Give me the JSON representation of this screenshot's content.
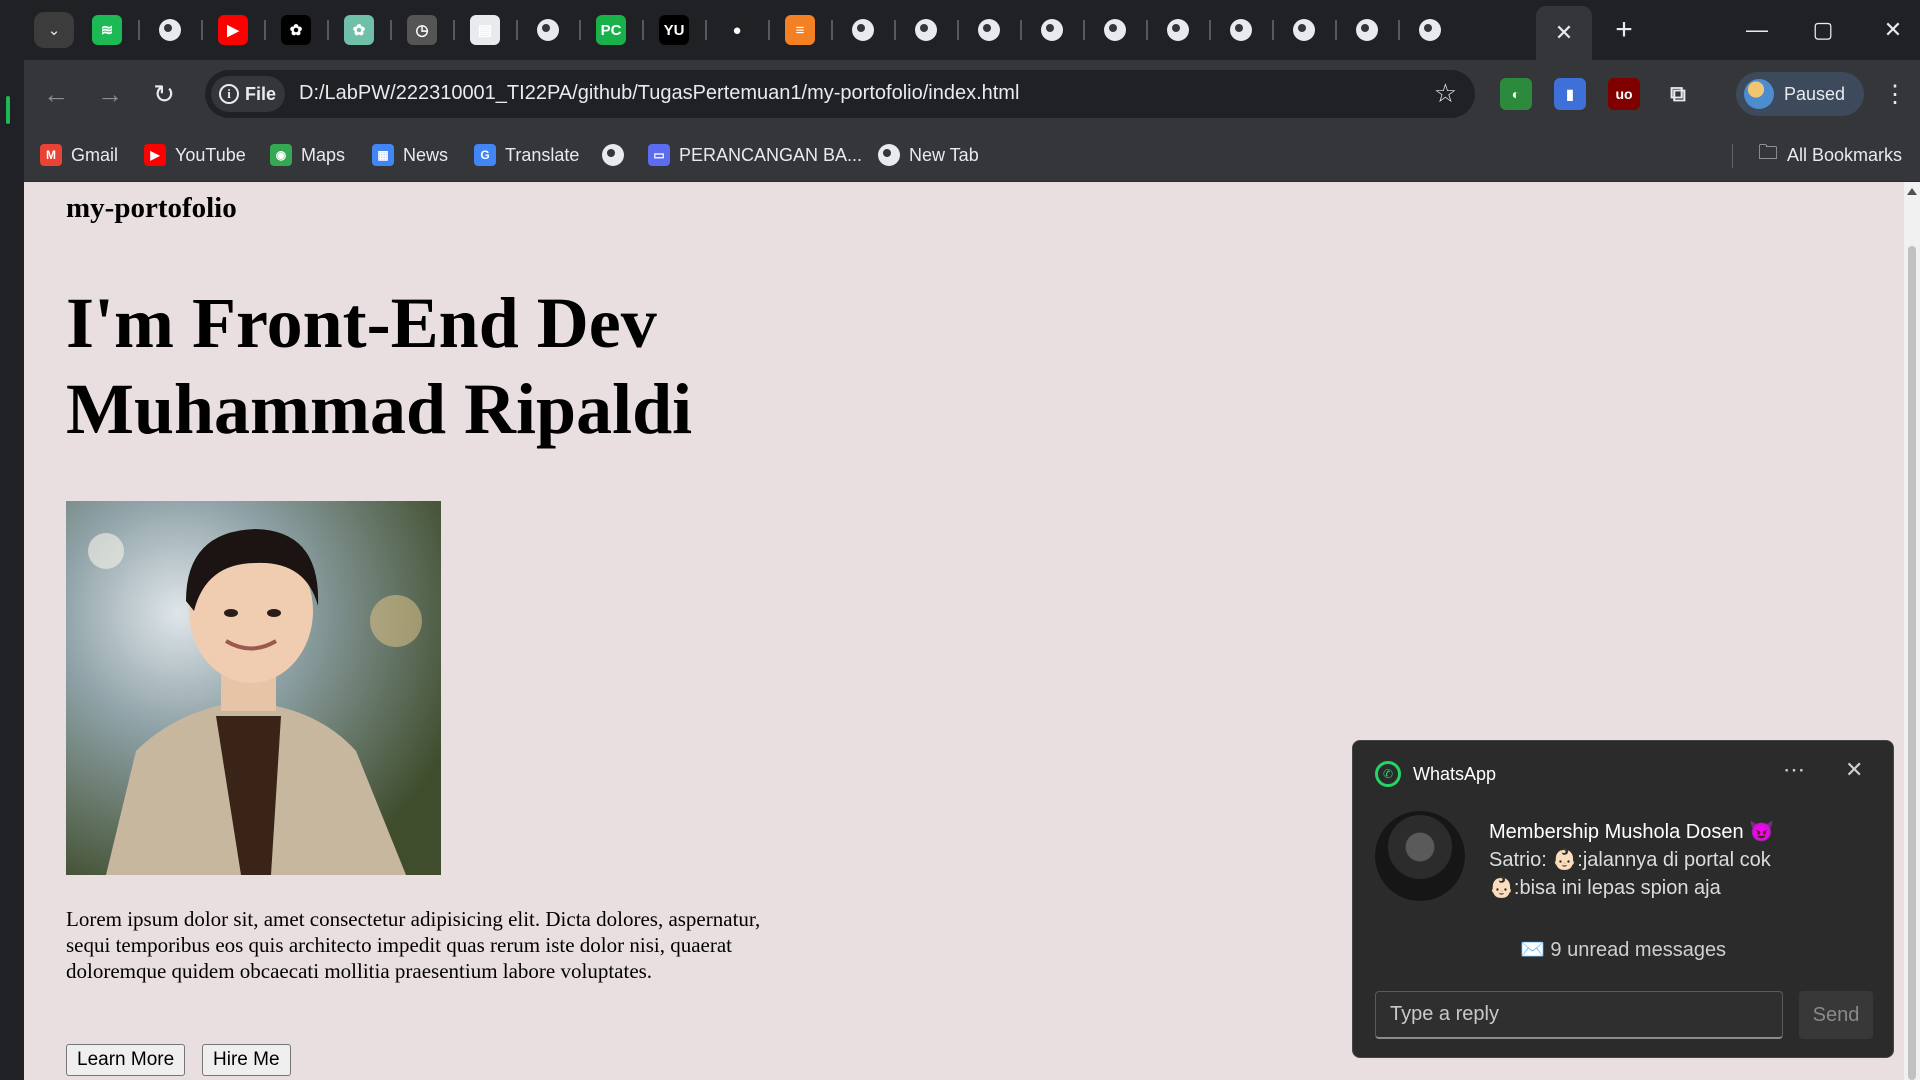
{
  "browser": {
    "tabs": [
      {
        "icon": "spotify-icon",
        "glyph": "≋",
        "color": "#1db954"
      },
      {
        "icon": "globe-icon",
        "glyph": "",
        "color": "#e8eaed"
      },
      {
        "icon": "youtube-icon",
        "glyph": "▶",
        "color": "#ff0000"
      },
      {
        "icon": "openai-icon",
        "glyph": "✿",
        "color": "#000000"
      },
      {
        "icon": "chatgpt-icon",
        "glyph": "✿",
        "color": "#6fbfa9"
      },
      {
        "icon": "clock-icon",
        "glyph": "◷",
        "color": "#555555"
      },
      {
        "icon": "document-icon",
        "glyph": "▤",
        "color": "#e8eaed"
      },
      {
        "icon": "globe-icon",
        "glyph": "",
        "color": "#e8eaed"
      },
      {
        "icon": "pycharm-icon",
        "glyph": "PC",
        "color": "#19b14a"
      },
      {
        "icon": "yu-icon",
        "glyph": "YU",
        "color": "#000000"
      },
      {
        "icon": "github-icon",
        "glyph": "●",
        "color": "#202124"
      },
      {
        "icon": "stackoverflow-icon",
        "glyph": "≡",
        "color": "#f48024"
      },
      {
        "icon": "globe-icon",
        "glyph": "",
        "color": "#e8eaed"
      },
      {
        "icon": "globe-icon",
        "glyph": "",
        "color": "#e8eaed"
      },
      {
        "icon": "globe-icon",
        "glyph": "",
        "color": "#e8eaed"
      },
      {
        "icon": "globe-icon",
        "glyph": "",
        "color": "#e8eaed"
      },
      {
        "icon": "globe-icon",
        "glyph": "",
        "color": "#e8eaed"
      },
      {
        "icon": "globe-icon",
        "glyph": "",
        "color": "#e8eaed"
      },
      {
        "icon": "globe-icon",
        "glyph": "",
        "color": "#e8eaed"
      },
      {
        "icon": "globe-icon",
        "glyph": "",
        "color": "#e8eaed"
      },
      {
        "icon": "globe-icon",
        "glyph": "",
        "color": "#e8eaed"
      },
      {
        "icon": "globe-icon",
        "glyph": "",
        "color": "#e8eaed"
      }
    ],
    "address": {
      "scheme_label": "File",
      "url": "D:/LabPW/222310001_TI22PA/github/TugasPertemuan1/my-portofolio/index.html"
    },
    "profile": {
      "label": "Paused"
    },
    "bookmarks": [
      {
        "label": "Gmail",
        "icon": "gmail-icon",
        "glyph": "M",
        "color": "#ea4335"
      },
      {
        "label": "YouTube",
        "icon": "youtube-icon",
        "glyph": "▶",
        "color": "#ff0000"
      },
      {
        "label": "Maps",
        "icon": "maps-icon",
        "glyph": "◉",
        "color": "#34a853"
      },
      {
        "label": "News",
        "icon": "news-icon",
        "glyph": "▦",
        "color": "#4285f4"
      },
      {
        "label": "Translate",
        "icon": "translate-icon",
        "glyph": "G",
        "color": "#4285f4"
      },
      {
        "label": "",
        "icon": "globe-icon",
        "glyph": "",
        "color": "#e8eaed"
      },
      {
        "label": "PERANCANGAN BA...",
        "icon": "classroom-icon",
        "glyph": "▭",
        "color": "#5b6cf0"
      },
      {
        "label": "New Tab",
        "icon": "globe-icon",
        "glyph": "",
        "color": "#e8eaed"
      }
    ],
    "all_bookmarks_label": "All Bookmarks"
  },
  "page": {
    "site_title": "my-portofolio",
    "hero_line1": "I'm Front-End Dev",
    "hero_line2": "Muhammad Ripaldi",
    "paragraph": "Lorem ipsum dolor sit, amet consectetur adipisicing elit. Dicta dolores, aspernatur, sequi temporibus eos quis architecto impedit quas rerum iste dolor nisi, quaerat doloremque quidem obcaecati mollitia praesentium labore voluptates.",
    "learn_more_label": "Learn More",
    "hire_me_label": "Hire Me"
  },
  "notification": {
    "app_name": "WhatsApp",
    "chat_title": "Membership Mushola Dosen 😈",
    "line1": "Satrio: 👶🏻:jalannya di portal cok",
    "line2": "👶🏻:bisa ini lepas spion aja",
    "unread": "✉️ 9 unread messages",
    "reply_placeholder": "Type a reply",
    "send_label": "Send"
  }
}
